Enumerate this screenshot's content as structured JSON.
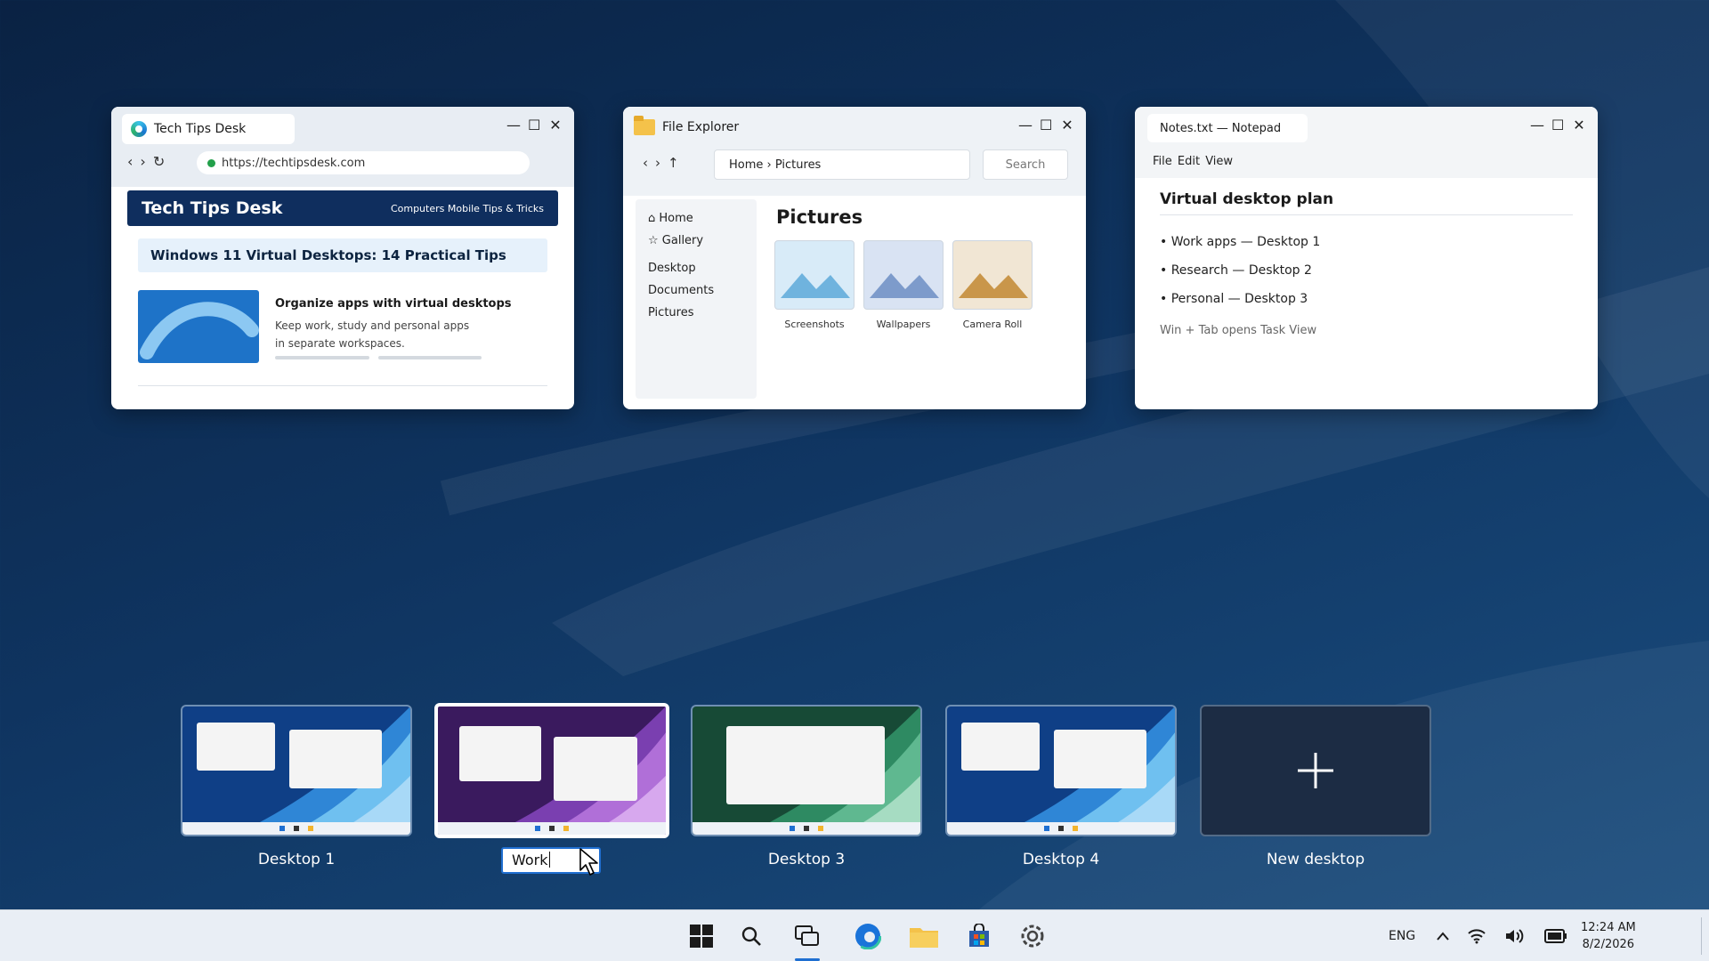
{
  "windows": {
    "browser": {
      "tab_title": "Tech Tips Desk",
      "url": "https://techtipsdesk.com",
      "site_title": "Tech Tips Desk",
      "site_tagline": "Computers Mobile Tips & Tricks",
      "article_title": "Windows 11 Virtual Desktops: 14 Practical Tips",
      "card_heading": "Organize apps with virtual desktops",
      "card_body_line1": "Keep work, study and personal apps",
      "card_body_line2": "in separate workspaces."
    },
    "explorer": {
      "title": "File Explorer",
      "path": "Home › Pictures",
      "search_placeholder": "Search",
      "sidebar": [
        "⌂ Home",
        "☆ Gallery",
        "Desktop",
        "Documents",
        "Pictures"
      ],
      "heading": "Pictures",
      "folders": [
        "Screenshots",
        "Wallpapers",
        "Camera Roll"
      ]
    },
    "notepad": {
      "tab_title": "Notes.txt — Notepad",
      "menu": "File Edit View",
      "heading": "Virtual desktop plan",
      "lines": [
        "• Work apps — Desktop 1",
        "• Research — Desktop 2",
        "• Personal — Desktop 3"
      ],
      "hint": "Win + Tab opens Task View"
    }
  },
  "desktops": {
    "items": [
      "Desktop 1",
      "Work",
      "Desktop 3",
      "Desktop 4"
    ],
    "active_index": 1,
    "rename_value": "Work",
    "new_label": "New desktop"
  },
  "taskbar": {
    "icons": [
      "start-icon",
      "search-icon",
      "task-view-icon",
      "edge-icon",
      "file-explorer-icon",
      "store-icon",
      "settings-icon"
    ],
    "language": "ENG",
    "time": "12:24 AM",
    "date": "8/2/2026"
  },
  "colors": {
    "accent": "#1f6fd1",
    "desktop_blue": "#0f3f86",
    "desktop_purple": "#3a1a5e",
    "desktop_green": "#174a36"
  }
}
